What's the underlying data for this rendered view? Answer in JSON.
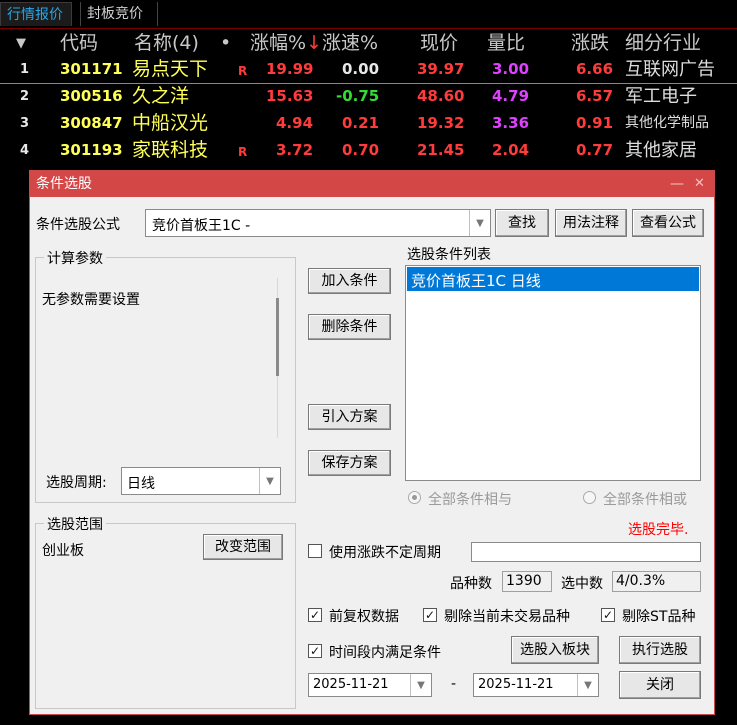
{
  "tabs": [
    "行情报价",
    "封板竞价"
  ],
  "header": {
    "sort_arrow": "▼",
    "code": "代码",
    "name": "名称(4)",
    "dot": "•",
    "change_pct": "涨幅%",
    "change_arrow": "↓",
    "speed": "涨速%",
    "price": "现价",
    "volume_ratio": "量比",
    "change": "涨跌",
    "industry": "细分行业"
  },
  "rows": [
    {
      "idx": "1",
      "code": "301171",
      "name": "易点天下",
      "flag": "R",
      "change_pct": "19.99",
      "speed": "0.00",
      "price": "39.97",
      "volume_ratio": "3.00",
      "change": "6.66",
      "industry": "互联网广告"
    },
    {
      "idx": "2",
      "code": "300516",
      "name": "久之洋",
      "flag": "",
      "change_pct": "15.63",
      "speed": "-0.75",
      "price": "48.60",
      "volume_ratio": "4.79",
      "change": "6.57",
      "industry": "军工电子"
    },
    {
      "idx": "3",
      "code": "300847",
      "name": "中船汉光",
      "flag": "",
      "change_pct": "4.94",
      "speed": "0.21",
      "price": "19.32",
      "volume_ratio": "3.36",
      "change": "0.91",
      "industry": "其他化学制品"
    },
    {
      "idx": "4",
      "code": "301193",
      "name": "家联科技",
      "flag": "R",
      "change_pct": "3.72",
      "speed": "0.70",
      "price": "21.45",
      "volume_ratio": "2.04",
      "change": "0.77",
      "industry": "其他家居"
    }
  ],
  "dialog": {
    "title": "条件选股",
    "min_glyph": "—",
    "close_glyph": "✕",
    "formula_label": "条件选股公式",
    "formula_value": "竞价首板王1C  -",
    "find_button": "查找",
    "usage_button": "用法注释",
    "view_formula_button": "查看公式",
    "params_group": "计算参数",
    "params_text": "无参数需要设置",
    "period_label": "选股周期:",
    "period_value": "日线",
    "add_condition": "加入条件",
    "delete_condition": "删除条件",
    "import_plan": "引入方案",
    "save_plan": "保存方案",
    "cond_list_label": "选股条件列表",
    "cond_list_items": [
      "竞价首板王1C  日线"
    ],
    "radio_and": "全部条件相与",
    "radio_or": "全部条件相或",
    "status": "选股完毕.",
    "range_group": "选股范围",
    "range_value": "创业板",
    "change_range": "改变范围",
    "use_uncertain_period": "使用涨跌不定周期",
    "count_label": "品种数",
    "count_value": "1390",
    "selected_label": "选中数",
    "selected_value": "4/0.3%",
    "opt_forward_adjust": "前复权数据",
    "opt_exclude_untraded": "剔除当前未交易品种",
    "opt_exclude_st": "剔除ST品种",
    "opt_time_range": "时间段内满足条件",
    "to_block_button": "选股入板块",
    "execute_button": "执行选股",
    "date_from": "2025-11-21",
    "date_sep": "-",
    "date_to": "2025-11-21",
    "close_button": "关闭"
  },
  "colors": {
    "up": "#ff3b3b",
    "down": "#33dd33",
    "code": "#ffff55",
    "ratio": "#e040ff",
    "titlebar": "#d44747",
    "selection": "#0078d7",
    "status": "#ff0000"
  }
}
